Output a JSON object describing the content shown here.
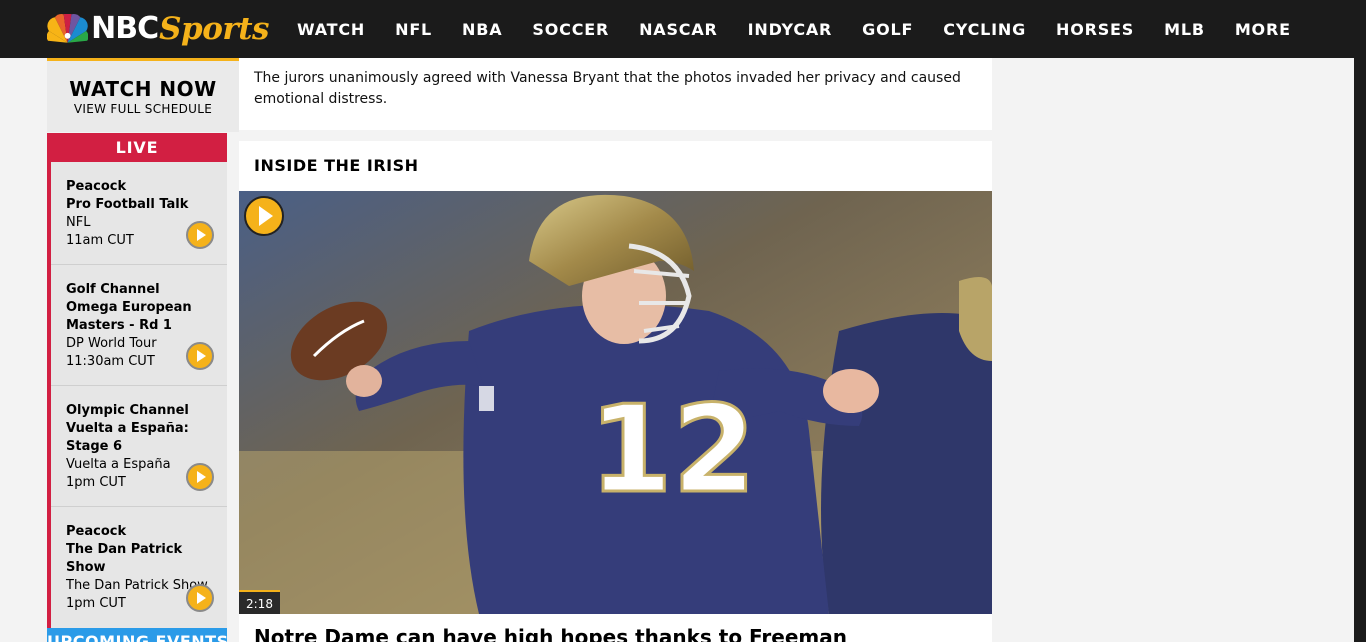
{
  "brand": {
    "logo_text_a": "NBC",
    "logo_text_b": "Sports",
    "accent": "#f5b21a"
  },
  "nav": {
    "items": [
      "WATCH",
      "NFL",
      "NBA",
      "SOCCER",
      "NASCAR",
      "INDYCAR",
      "GOLF",
      "CYCLING",
      "HORSES",
      "MLB",
      "MORE"
    ]
  },
  "watch_now": {
    "title": "WATCH NOW",
    "subtitle": "VIEW FULL SCHEDULE"
  },
  "live": {
    "label": "LIVE",
    "items": [
      {
        "network": "Peacock",
        "show": "Pro Football Talk",
        "sub": "NFL",
        "time": "11am CUT"
      },
      {
        "network": "Golf Channel",
        "show": "Omega European Masters - Rd 1",
        "sub": "DP World Tour",
        "time": "11:30am CUT"
      },
      {
        "network": "Olympic Channel",
        "show": "Vuelta a España: Stage 6",
        "sub": "Vuelta a España",
        "time": "1pm CUT"
      },
      {
        "network": "Peacock",
        "show": "The Dan Patrick Show",
        "sub": "The Dan Patrick Show",
        "time": "1pm CUT"
      }
    ]
  },
  "upcoming": {
    "label": "UPCOMING EVENTS"
  },
  "teaser": {
    "text": "The jurors unanimously agreed with Vanessa Bryant that the photos invaded her privacy and caused emotional distress."
  },
  "feature": {
    "heading": "INSIDE THE IRISH",
    "duration": "2:18",
    "title": "Notre Dame can have high hopes thanks to Freeman",
    "jersey_number": "12"
  }
}
